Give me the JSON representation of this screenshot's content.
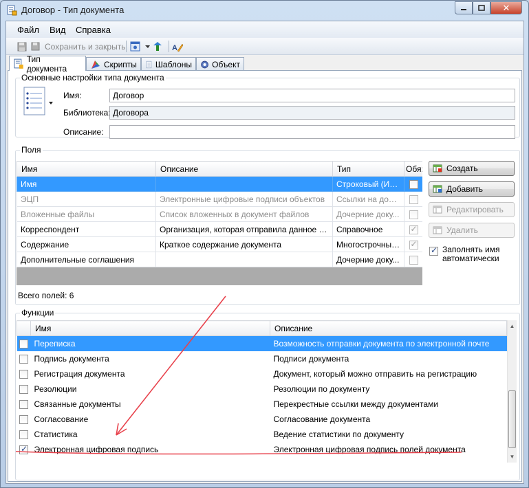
{
  "window": {
    "title": "Договор - Тип документа",
    "close_glyph": "✕"
  },
  "menu": [
    "Файл",
    "Вид",
    "Справка"
  ],
  "toolbar": {
    "save_close_label": "Сохранить и закрыть"
  },
  "tabs": [
    {
      "label": "Тип документа",
      "icon": "document-type-icon",
      "active": true
    },
    {
      "label": "Скрипты",
      "icon": "scripts-icon",
      "active": false
    },
    {
      "label": "Шаблоны",
      "icon": "templates-icon",
      "active": false
    },
    {
      "label": "Объект",
      "icon": "object-icon",
      "active": false
    }
  ],
  "basic": {
    "group_title": "Основные настройки типа документа",
    "name_label": "Имя:",
    "name_value": "Договор",
    "library_label": "Библиотека:",
    "library_value": "Договора",
    "description_label": "Описание:",
    "description_value": ""
  },
  "fields": {
    "group_title": "Поля",
    "columns": [
      "Имя",
      "Описание",
      "Тип",
      "Обя:"
    ],
    "rows": [
      {
        "name": "Имя",
        "description": "",
        "type": "Строковый (Инд...",
        "required": false,
        "selected": true,
        "dim": false,
        "disabled": false
      },
      {
        "name": "ЭЦП",
        "description": "Электронные цифровые подписи объектов",
        "type": "Ссылки на доку...",
        "required": false,
        "selected": false,
        "dim": true,
        "disabled": true
      },
      {
        "name": "Вложенные файлы",
        "description": "Список вложенных в документ файлов",
        "type": "Дочерние доку...",
        "required": false,
        "selected": false,
        "dim": true,
        "disabled": true
      },
      {
        "name": "Корреспондент",
        "description": "Организация, которая отправила данное письмо",
        "type": "Справочное",
        "required": true,
        "selected": false,
        "dim": false,
        "disabled": true
      },
      {
        "name": "Содержание",
        "description": "Краткое содержание документа",
        "type": "Многострочный ...",
        "required": true,
        "selected": false,
        "dim": false,
        "disabled": true
      },
      {
        "name": "Дополнительные соглашения",
        "description": "",
        "type": "Дочерние доку...",
        "required": false,
        "selected": false,
        "dim": false,
        "disabled": true
      }
    ],
    "total_label": "Всего полей: 6",
    "buttons": {
      "create": "Создать",
      "add": "Добавить",
      "edit": "Редактировать",
      "delete": "Удалить"
    },
    "autofill_label_line1": "Заполнять имя",
    "autofill_label_line2": "автоматически",
    "autofill_checked": true
  },
  "functions": {
    "group_title": "Функции",
    "columns": [
      "Имя",
      "Описание"
    ],
    "rows": [
      {
        "name": "Переписка",
        "description": "Возможность отправки документа по электронной почте",
        "checked": false,
        "selected": true
      },
      {
        "name": "Подпись документа",
        "description": "Подписи документа",
        "checked": false,
        "selected": false
      },
      {
        "name": "Регистрация документа",
        "description": "Документ, который можно отправить на регистрацию",
        "checked": false,
        "selected": false
      },
      {
        "name": "Резолюции",
        "description": "Резолюции по документу",
        "checked": false,
        "selected": false
      },
      {
        "name": "Связанные документы",
        "description": "Перекрестные ссылки между документами",
        "checked": false,
        "selected": false
      },
      {
        "name": "Согласование",
        "description": "Согласование документа",
        "checked": false,
        "selected": false
      },
      {
        "name": "Статистика",
        "description": "Ведение статистики по документу",
        "checked": false,
        "selected": false
      },
      {
        "name": "Электронная цифровая подпись",
        "description": "Электронная цифровая подпись полей документа",
        "checked": true,
        "selected": false
      }
    ]
  },
  "colors": {
    "selection": "#3399ff",
    "annotation": "#e8424c"
  }
}
